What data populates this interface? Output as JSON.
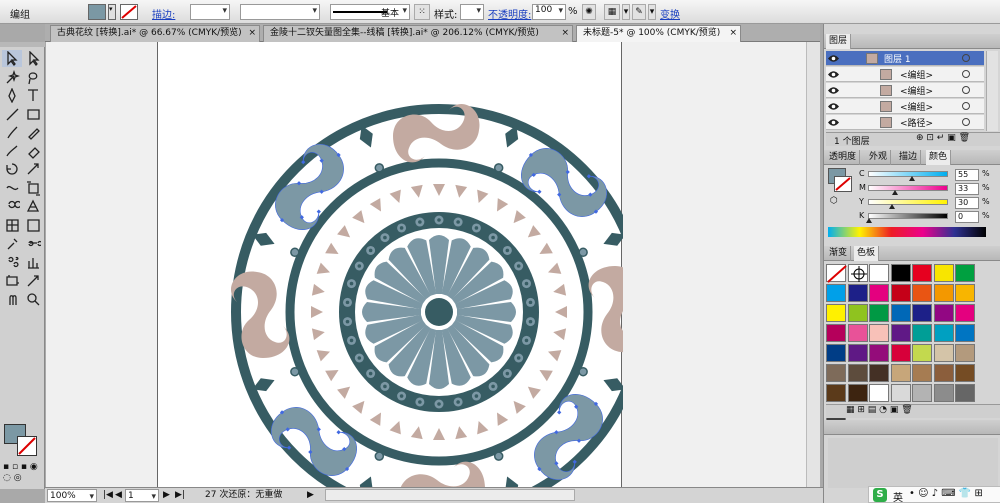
{
  "control_bar": {
    "selection_label": "编组",
    "fill_color": "#7b98a4",
    "stroke_label": "描边:",
    "stroke_weight": "",
    "stroke_style_label": "基本",
    "style_label": "样式:",
    "opacity_label": "不透明度:",
    "opacity_value": "100",
    "opacity_unit": "%",
    "transform_label": "变换"
  },
  "tabs": [
    {
      "label": "古典花纹 [转换].ai* @ 66.67% (CMYK/预览)",
      "close": "×"
    },
    {
      "label": "金陵十二钗矢量图全集--线稿 [转换].ai* @ 206.12% (CMYK/预览)",
      "close": "×"
    },
    {
      "label": "未标题-5* @ 100% (CMYK/预览)",
      "close": "×"
    }
  ],
  "status": {
    "zoom": "100%",
    "page": "1",
    "history": "27 次还原：无重做"
  },
  "layers_panel": {
    "title": "图层",
    "rows": [
      {
        "label": "图层 1",
        "highlight": true
      },
      {
        "label": "<编组>"
      },
      {
        "label": "<编组>"
      },
      {
        "label": "<编组>"
      },
      {
        "label": "<路径>"
      }
    ],
    "count_label": "1 个图层"
  },
  "color_panel": {
    "tabs": [
      "透明度",
      "外观",
      "描边",
      "颜色"
    ],
    "channels": [
      {
        "name": "C",
        "value": "55",
        "unit": "%"
      },
      {
        "name": "M",
        "value": "33",
        "unit": "%"
      },
      {
        "name": "Y",
        "value": "30",
        "unit": "%"
      },
      {
        "name": "K",
        "value": "0",
        "unit": "%"
      }
    ]
  },
  "swatches_panel": {
    "tabs": [
      "渐变",
      "色板"
    ],
    "colors": [
      "#ffffff",
      "#000000",
      "#e6001f",
      "#f8e500",
      "#00a040",
      "#00a0e9",
      "#1d2088",
      "#e4007f",
      "#c50018",
      "#e95513",
      "#f39800",
      "#f8b500",
      "#fff100",
      "#8fc31f",
      "#009944",
      "#0068b7",
      "#1d2088",
      "#920783",
      "#e4007f",
      "#b5005b",
      "#e85298",
      "#f8c1b8",
      "#601986",
      "#009e96",
      "#00a0c1",
      "#0075c2",
      "#003d86",
      "#5f1985",
      "#940c7a",
      "#d7003a",
      "#c3d94e",
      "#d4c4a8",
      "#b39a7d",
      "#7e6b5a",
      "#5d4c3d",
      "#443025",
      "#c7a67a",
      "#a67c52",
      "#8b5e3c",
      "#754c24",
      "#5b3a1a",
      "#3d2410",
      "#ffffff",
      "#d9d9d9",
      "#b3b3b3",
      "#8c8c8c",
      "#666666",
      "#404040"
    ]
  },
  "ime": {
    "lang": "英"
  },
  "colors": {
    "teal": "#375c63",
    "blue": "#7c98a5",
    "beige": "#c3aaa1",
    "selection": "#4169e1"
  }
}
